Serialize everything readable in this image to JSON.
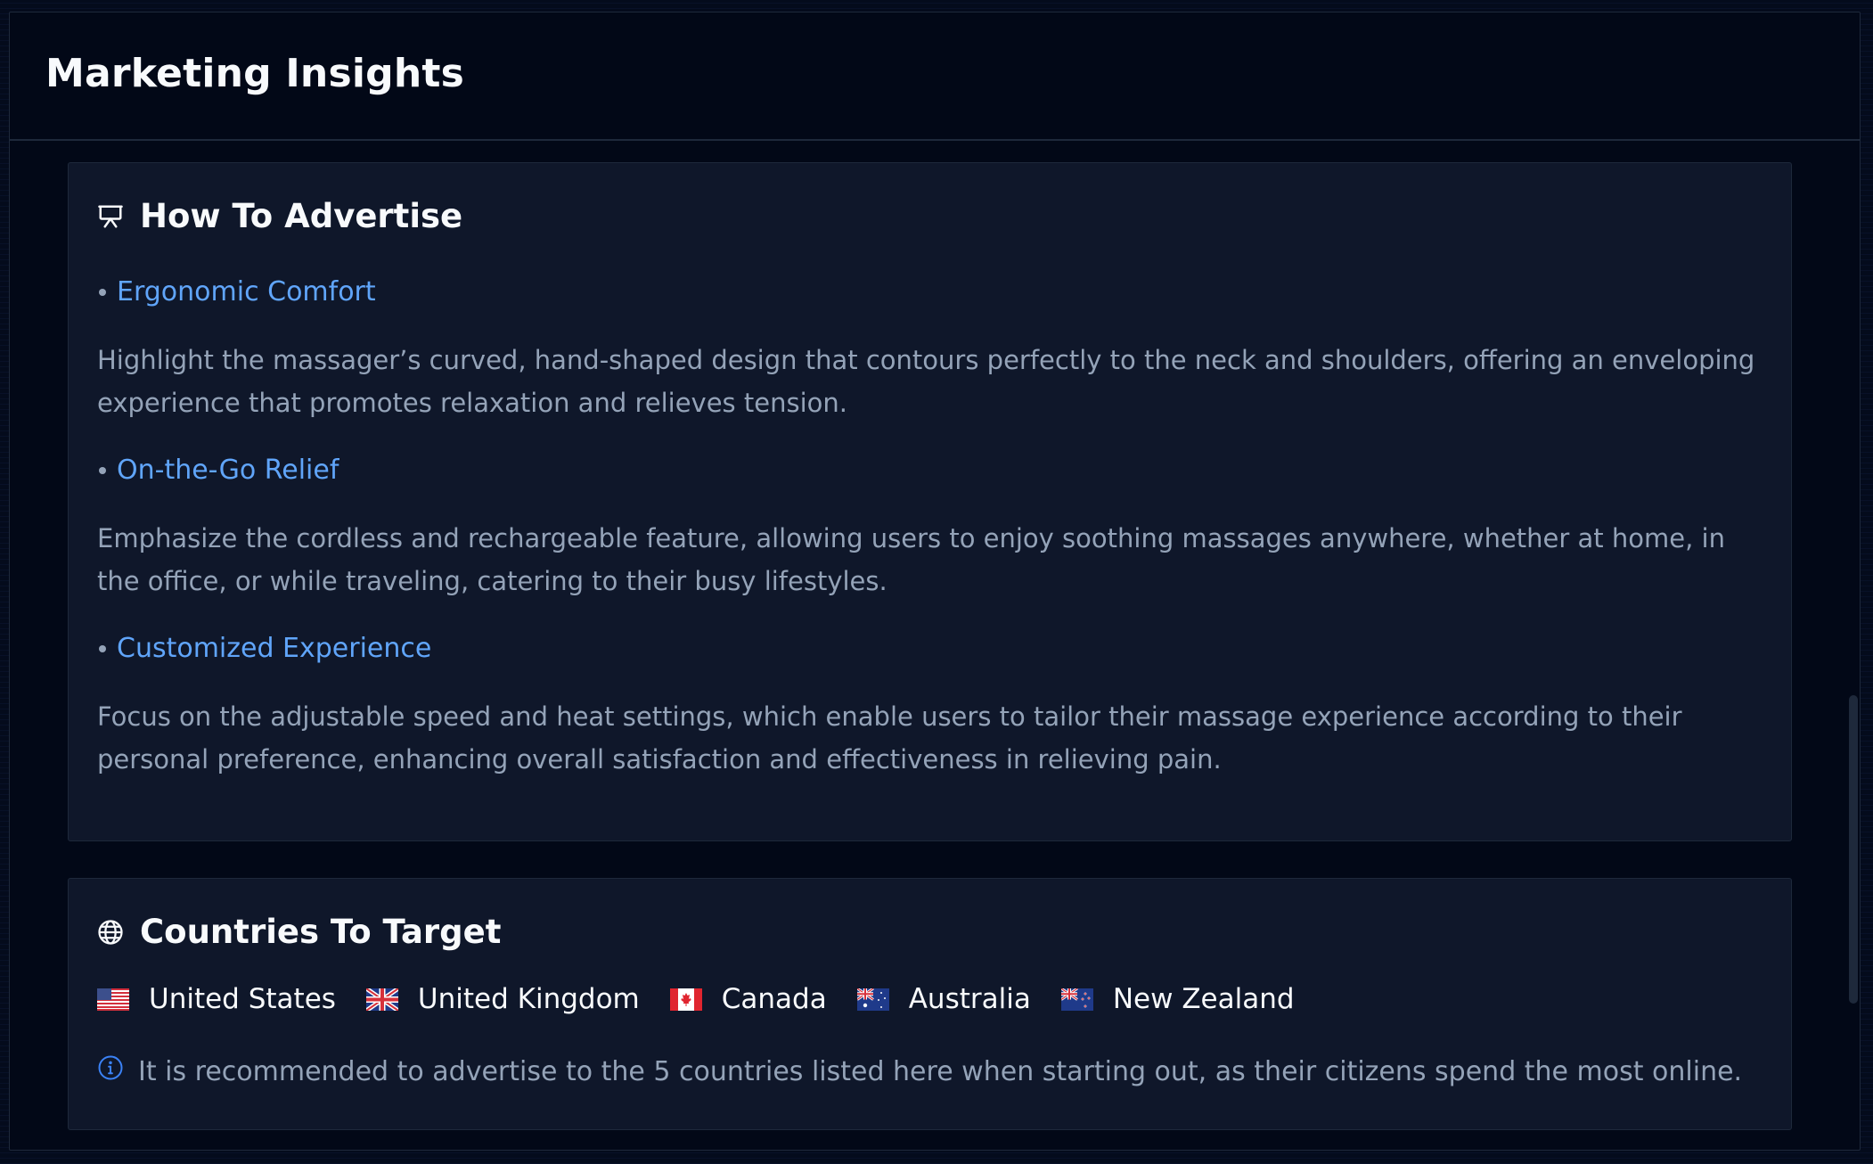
{
  "panel": {
    "title": "Marketing Insights"
  },
  "advertise": {
    "icon": "presentation-icon",
    "title": "How To Advertise",
    "items": [
      {
        "heading": "Ergonomic Comfort",
        "description": "Highlight the massager’s curved, hand-shaped design that contours perfectly to the neck and shoulders, offering an enveloping experience that promotes relaxation and relieves tension."
      },
      {
        "heading": "On-the-Go Relief",
        "description": "Emphasize the cordless and rechargeable feature, allowing users to enjoy soothing massages anywhere, whether at home, in the office, or while traveling, catering to their busy lifestyles."
      },
      {
        "heading": "Customized Experience",
        "description": "Focus on the adjustable speed and heat settings, which enable users to tailor their massage experience according to their personal preference, enhancing overall satisfaction and effectiveness in relieving pain."
      }
    ]
  },
  "countries": {
    "icon": "globe-icon",
    "title": "Countries To Target",
    "list": [
      {
        "flag": "us-flag-icon",
        "name": "United States"
      },
      {
        "flag": "uk-flag-icon",
        "name": "United Kingdom"
      },
      {
        "flag": "canada-flag-icon",
        "name": "Canada"
      },
      {
        "flag": "australia-flag-icon",
        "name": "Australia"
      },
      {
        "flag": "new-zealand-flag-icon",
        "name": "New Zealand"
      }
    ],
    "note_icon": "info-icon",
    "note": "It is recommended to advertise to the 5 countries listed here when starting out, as their citizens spend the most online."
  },
  "colors": {
    "background": "#020817",
    "card": "#0f172a",
    "border": "#1e293b",
    "accent": "#60a5fa",
    "muted_text": "#94a3b8",
    "heading_text": "#f8fafc"
  }
}
